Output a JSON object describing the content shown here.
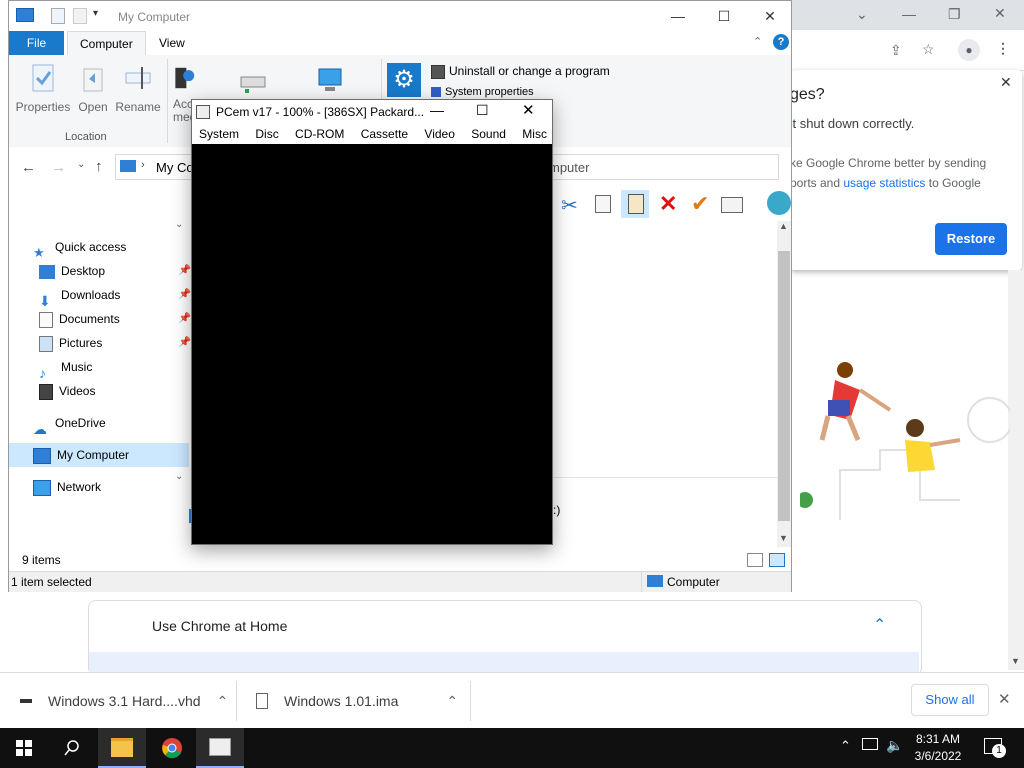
{
  "explorer": {
    "title": "My Computer",
    "tabs": {
      "file": "File",
      "computer": "Computer",
      "view": "View"
    },
    "ribbon": {
      "properties": "Properties",
      "open": "Open",
      "rename": "Rename",
      "location_group": "Location",
      "access_media_partial": "Acc",
      "access_media_partial2": "med",
      "uninstall": "Uninstall or change a program",
      "system_properties": "System properties"
    },
    "address_prefix": "My Co",
    "address_suffix": "mputer",
    "nav": {
      "quick_access": "Quick access",
      "desktop": "Desktop",
      "downloads": "Downloads",
      "documents": "Documents",
      "pictures": "Pictures",
      "music": "Music",
      "videos": "Videos",
      "onedrive": "OneDrive",
      "my_computer": "My Computer",
      "network": "Network"
    },
    "content_partial": ":)",
    "status_items": "9 items",
    "status_selected": "1 item selected",
    "status_location": "Computer"
  },
  "pcem": {
    "title": "PCem v17 - 100% - [386SX] Packard...",
    "menu": [
      "System",
      "Disc",
      "CD-ROM",
      "Cassette",
      "Video",
      "Sound",
      "Misc"
    ]
  },
  "chrome": {
    "restore_title_partial": "ges?",
    "restore_line1": "'t shut down correctly.",
    "restore_line2": "ke Google Chrome better by sending",
    "restore_line3_pre": "ports and ",
    "restore_link": "usage statistics",
    "restore_line3_post": " to Google",
    "restore_button": "Restore",
    "use_chrome": "Use Chrome at Home"
  },
  "downloads": {
    "item1": "Windows 3.1 Hard....vhd",
    "item2": "Windows 1.01.ima",
    "show_all": "Show all"
  },
  "taskbar": {
    "time": "8:31 AM",
    "date": "3/6/2022",
    "notifications": "1"
  },
  "colors": {
    "accent": "#1979ca",
    "chrome_blue": "#1a73e8",
    "taskbar": "#101010"
  }
}
